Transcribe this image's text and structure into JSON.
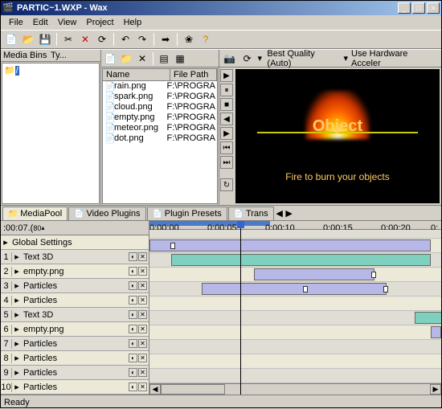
{
  "window": {
    "title": "PARTIC~1.WXP - Wax"
  },
  "menu": [
    "File",
    "Edit",
    "View",
    "Project",
    "Help"
  ],
  "mediabins": {
    "header": "Media Bins",
    "type_hdr": "Ty...",
    "root": "/"
  },
  "filelist": {
    "hdr_name": "Name",
    "hdr_path": "File Path",
    "rows": [
      {
        "name": "rain.png",
        "path": "F:\\PROGRA"
      },
      {
        "name": "spark.png",
        "path": "F:\\PROGRA"
      },
      {
        "name": "cloud.png",
        "path": "F:\\PROGRA"
      },
      {
        "name": "empty.png",
        "path": "F:\\PROGRA"
      },
      {
        "name": "meteor.png",
        "path": "F:\\PROGRA"
      },
      {
        "name": "dot.png",
        "path": "F:\\PROGRA"
      }
    ]
  },
  "preview": {
    "quality": "Best Quality (Auto)",
    "hw": "Use Hardware Acceler",
    "object_text": "Object",
    "caption": "Fire to burn your objects"
  },
  "tabs": [
    "MediaPool",
    "Video Plugins",
    "Plugin Presets",
    "Trans"
  ],
  "timeline": {
    "time": ":00:07.(",
    "spinner": "80",
    "global": "Global Settings",
    "ticks": [
      "0:00:00",
      "0:00:05",
      "0:00:10",
      "0:00:15",
      "0:00:20",
      "0:"
    ],
    "tracks": [
      {
        "n": "1",
        "name": "Text 3D"
      },
      {
        "n": "2",
        "name": "empty.png"
      },
      {
        "n": "3",
        "name": "Particles"
      },
      {
        "n": "4",
        "name": "Particles"
      },
      {
        "n": "5",
        "name": "Text 3D"
      },
      {
        "n": "6",
        "name": "empty.png"
      },
      {
        "n": "7",
        "name": "Particles"
      },
      {
        "n": "8",
        "name": "Particles"
      },
      {
        "n": "9",
        "name": "Particles"
      },
      {
        "n": "10",
        "name": "Particles"
      }
    ]
  },
  "status": "Ready"
}
